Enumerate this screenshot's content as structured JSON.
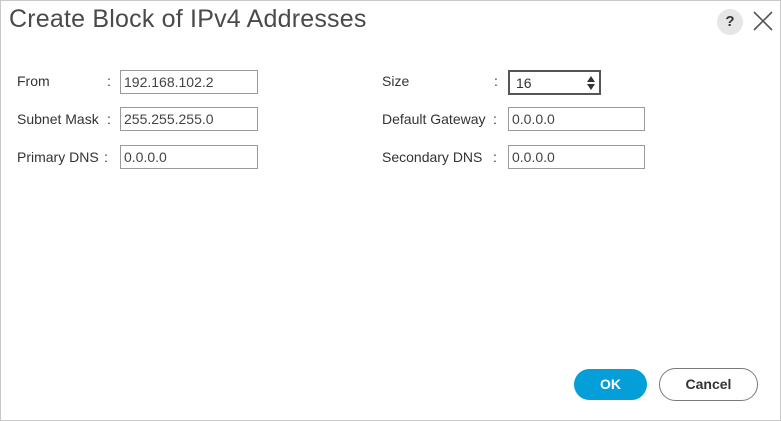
{
  "dialog": {
    "title": "Create Block of IPv4 Addresses",
    "help_label": "?"
  },
  "form": {
    "separator": ":",
    "from": {
      "label": "From",
      "value": "192.168.102.2"
    },
    "subnet_mask": {
      "label": "Subnet Mask",
      "value": "255.255.255.0"
    },
    "primary_dns": {
      "label": "Primary DNS",
      "value": "0.0.0.0"
    },
    "size": {
      "label": "Size",
      "value": "16"
    },
    "default_gateway": {
      "label": "Default Gateway",
      "value": "0.0.0.0"
    },
    "secondary_dns": {
      "label": "Secondary DNS",
      "value": "0.0.0.0"
    }
  },
  "actions": {
    "ok_label": "OK",
    "cancel_label": "Cancel"
  },
  "colors": {
    "primary_button": "#049fd9",
    "title_text": "#4a4a4a",
    "border": "#c8c8c8"
  },
  "icons": {
    "help": "help-icon",
    "close": "close-icon",
    "spinner": "chevron-up-down-icon"
  }
}
